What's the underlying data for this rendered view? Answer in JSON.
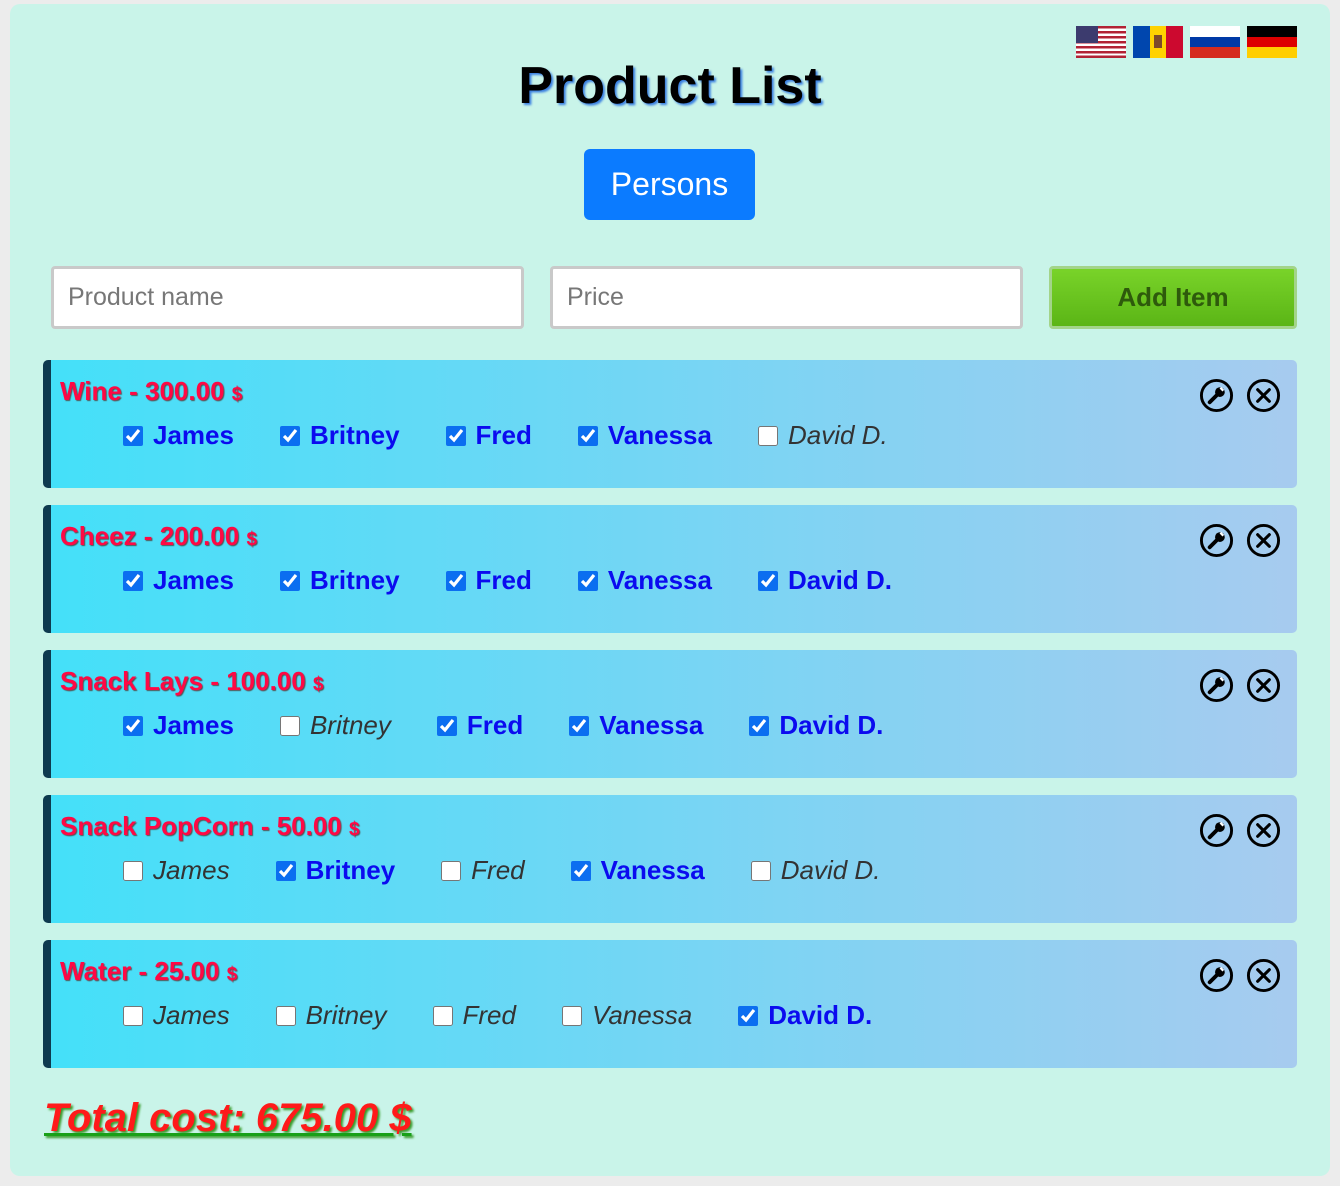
{
  "header": {
    "title": "Product List",
    "persons_button": "Persons",
    "flags": [
      "us-flag-icon",
      "moldova-flag-icon",
      "russia-flag-icon",
      "germany-flag-icon"
    ]
  },
  "form": {
    "name_placeholder": "Product name",
    "price_placeholder": "Price",
    "add_button": "Add Item"
  },
  "persons": [
    "James",
    "Britney",
    "Fred",
    "Vanessa",
    "David D."
  ],
  "items": [
    {
      "name": "Wine",
      "price": "300.00",
      "currency": "$",
      "checked": [
        true,
        true,
        true,
        true,
        false
      ]
    },
    {
      "name": "Cheez",
      "price": "200.00",
      "currency": "$",
      "checked": [
        true,
        true,
        true,
        true,
        true
      ]
    },
    {
      "name": "Snack Lays",
      "price": "100.00",
      "currency": "$",
      "checked": [
        true,
        false,
        true,
        true,
        true
      ]
    },
    {
      "name": "Snack PopCorn",
      "price": "50.00",
      "currency": "$",
      "checked": [
        false,
        true,
        false,
        true,
        false
      ]
    },
    {
      "name": "Water",
      "price": "25.00",
      "currency": "$",
      "checked": [
        false,
        false,
        false,
        false,
        true
      ]
    }
  ],
  "total": {
    "text": "Total cost: 675.00 $"
  },
  "colors": {
    "background": "#c9f4e9",
    "primary_button": "#0b7bff",
    "add_button": "#6cc520",
    "item_title": "#ff0844",
    "checked_person": "#0b0bef"
  }
}
